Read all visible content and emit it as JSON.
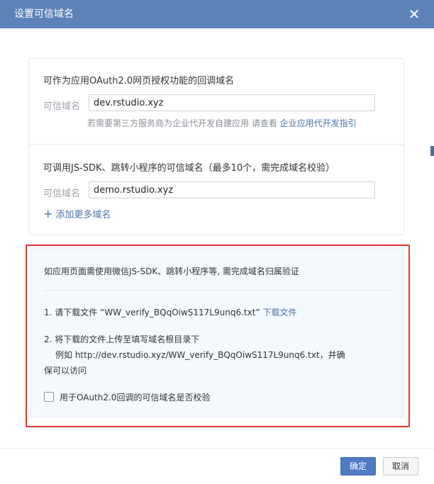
{
  "dialog": {
    "title": "设置可信域名",
    "close_symbol": "✕"
  },
  "oauth_section": {
    "title": "可作为应用OAuth2.0网页授权功能的回调域名",
    "field_label": "可信域名",
    "field_value": "dev.rstudio.xyz",
    "hint_text": "若需要第三方服务商为企业代开发自建应用 请查看",
    "hint_link": "企业应用代开发指引"
  },
  "jssdk_section": {
    "title": "可调用JS-SDK、跳转小程序的可信域名（最多10个，需完成域名校验）",
    "field_label": "可信域名",
    "field_value": "demo.rstudio.xyz",
    "add_more_plus": "+",
    "add_more_label": "添加更多域名"
  },
  "verify_box": {
    "heading": "如应用页面需使用微信JS-SDK、跳转小程序等, 需完成域名归属验证",
    "step1_text": "1. 请下载文件 “WW_verify_BQqOiwS117L9unq6.txt”",
    "step1_link": "下载文件",
    "step2_line1": "2. 将下载的文件上传至填写域名根目录下",
    "step2_line2": "例如 http://dev.rstudio.xyz/WW_verify_BQqOiwS117L9unq6.txt，并确",
    "step2_line3": "保可以访问",
    "checkbox_label": "用于OAuth2.0回调的可信域名是否校验",
    "checkbox_checked": false
  },
  "footer": {
    "confirm_label": "确定",
    "cancel_label": "取消"
  },
  "colors": {
    "titlebar": "#5d82b8",
    "accent": "#4a72a8",
    "highlight_border": "#e3342f",
    "confirm_button": "#4f7ac4"
  }
}
